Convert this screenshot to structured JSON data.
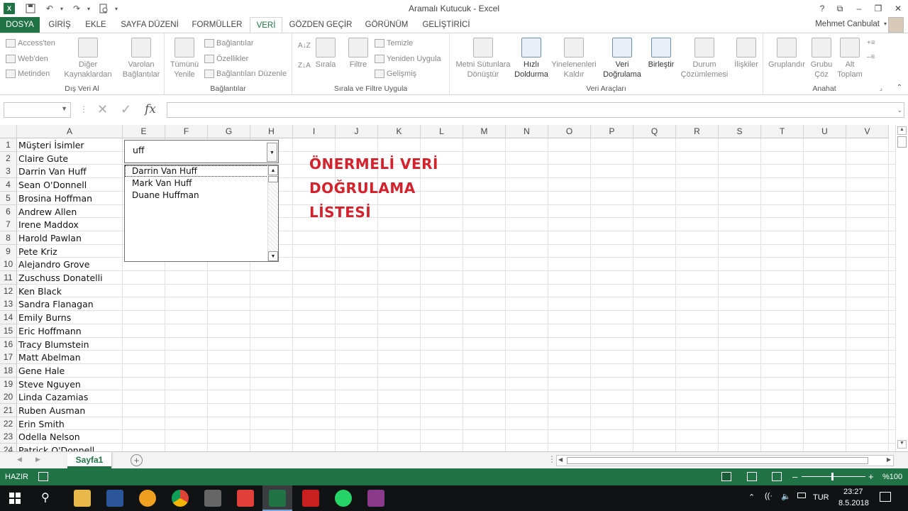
{
  "window": {
    "title": "Aramalı Kutucuk - Excel",
    "help": "?",
    "restore": "⧉",
    "minimize": "–",
    "maximize": "❐",
    "close": "✕"
  },
  "ribbon_tabs": [
    "DOSYA",
    "GİRİŞ",
    "EKLE",
    "SAYFA DÜZENİ",
    "FORMÜLLER",
    "VERİ",
    "GÖZDEN GEÇİR",
    "GÖRÜNÜM",
    "GELİŞTİRİCİ"
  ],
  "active_tab": "VERİ",
  "user": "Mehmet Canbulat",
  "groups": {
    "external": {
      "label": "Dış Veri Al",
      "access": "Access'ten",
      "web": "Web'den",
      "text": "Metinden",
      "other": "Diğer Kaynaklardan",
      "existing": "Varolan Bağlantılar"
    },
    "connections": {
      "label": "Bağlantılar",
      "refresh": "Tümünü Yenile",
      "conn": "Bağlantılar",
      "props": "Özellikler",
      "edit": "Bağlantıları Düzenle"
    },
    "sort": {
      "label": "Sırala ve Filtre Uygula",
      "sort": "Sırala",
      "filter": "Filtre",
      "clear": "Temizle",
      "reapply": "Yeniden Uygula",
      "advanced": "Gelişmiş"
    },
    "tools": {
      "label": "Veri Araçları",
      "t2c": "Metni Sütunlara Dönüştür",
      "flash": "Hızlı Doldurma",
      "dups": "Yinelenenleri Kaldır",
      "valid": "Veri Doğrulama",
      "consol": "Birleştir",
      "whatif": "Durum Çözümlemesi",
      "rel": "İlişkiler"
    },
    "outline": {
      "label": "Anahat",
      "group": "Gruplandır",
      "ungroup": "Grubu Çöz",
      "subtotal": "Alt Toplam"
    }
  },
  "formula_bar": {
    "fx": "fx",
    "cancel": "✕",
    "enter": "✓",
    "namebox": ""
  },
  "columns": [
    "A",
    "E",
    "F",
    "G",
    "H",
    "I",
    "J",
    "K",
    "L",
    "M",
    "N",
    "O",
    "P",
    "Q",
    "R",
    "S",
    "T",
    "U",
    "V"
  ],
  "rows": [
    "1",
    "2",
    "3",
    "4",
    "5",
    "6",
    "7",
    "8",
    "9",
    "10",
    "11",
    "12",
    "13",
    "14",
    "15",
    "16",
    "17",
    "18",
    "19",
    "20",
    "21",
    "22",
    "23",
    "24"
  ],
  "column_a": [
    "Müşteri İsimler",
    "Claire Gute",
    "Darrin Van Huff",
    "Sean O'Donnell",
    "Brosina Hoffman",
    "Andrew Allen",
    "Irene Maddox",
    "Harold Pawlan",
    "Pete Kriz",
    "Alejandro Grove",
    "Zuschuss Donatelli",
    "Ken Black",
    "Sandra Flanagan",
    "Emily Burns",
    "Eric Hoffmann",
    "Tracy Blumstein",
    "Matt Abelman",
    "Gene Hale",
    "Steve Nguyen",
    "Linda Cazamias",
    "Ruben Ausman",
    "Erin Smith",
    "Odella Nelson",
    "Patrick O'Donnell"
  ],
  "combo": {
    "value": "uff",
    "arrow": "▼"
  },
  "suggestions": [
    "Darrin Van Huff",
    "Mark Van Huff",
    "Duane Huffman"
  ],
  "heading": {
    "line1": "ÖNERMELİ VERİ",
    "line2": "DOĞRULAMA",
    "line3": "LİSTESİ"
  },
  "sheet": {
    "name": "Sayfa1",
    "add": "+"
  },
  "status": {
    "ready": "HAZIR",
    "zoom": "%100",
    "minus": "–",
    "plus": "+"
  },
  "taskbar": {
    "lang": "TUR",
    "time": "23:27",
    "date": "8.5.2018"
  },
  "colors": {
    "excel_green": "#217346",
    "heading_red": "#d4222d"
  }
}
